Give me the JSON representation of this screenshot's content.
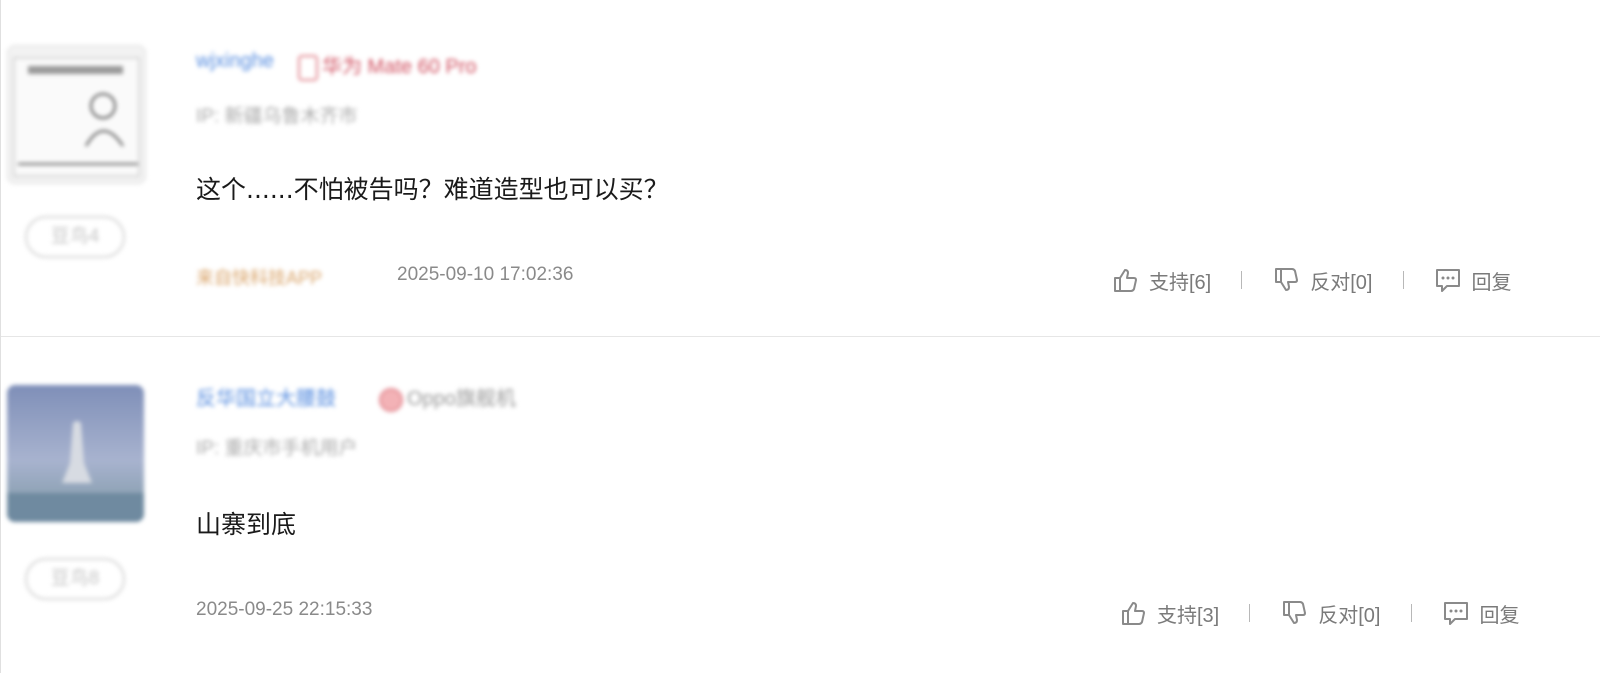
{
  "comments": [
    {
      "username": "wjxinghe",
      "device": "华为 Mate 60 Pro",
      "ip": "IP: 新疆乌鲁木齐市",
      "level": "豆鸟4",
      "content": "这个......不怕被告吗？难道造型也可以买？",
      "source": "来自快科技APP",
      "timestamp": "2025-09-10 17:02:36",
      "support_label": "支持[6]",
      "oppose_label": "反对[0]",
      "reply_label": "回复"
    },
    {
      "username": "反华国立大腰鼓",
      "device": "Oppo旗舰机",
      "ip": "IP: 重庆市手机用户",
      "level": "豆鸟8",
      "content": "山寨到底",
      "timestamp": "2025-09-25 22:15:33",
      "support_label": "支持[3]",
      "oppose_label": "反对[0]",
      "reply_label": "回复"
    }
  ],
  "icons": {
    "support": "thumbs-up-icon",
    "oppose": "thumbs-down-icon",
    "reply": "comment-icon"
  }
}
